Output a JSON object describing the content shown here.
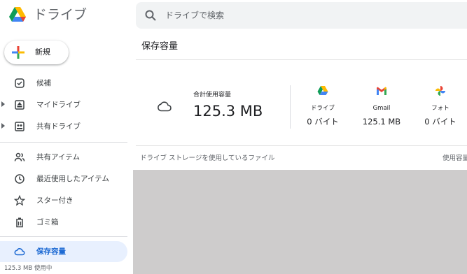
{
  "app": {
    "name": "ドライブ"
  },
  "search": {
    "placeholder": "ドライブで検索"
  },
  "sidebar": {
    "new_label": "新規",
    "items": [
      {
        "label": "候補"
      },
      {
        "label": "マイドライブ"
      },
      {
        "label": "共有ドライブ"
      },
      {
        "label": "共有アイテム"
      },
      {
        "label": "最近使用したアイテム"
      },
      {
        "label": "スター付き"
      },
      {
        "label": "ゴミ箱"
      },
      {
        "label": "保存容量"
      }
    ],
    "usage_text": "125.3 MB 使用中"
  },
  "main": {
    "title": "保存容量",
    "total_label": "合計使用容量",
    "total_value": "125.3 MB",
    "services": [
      {
        "name": "ドライブ",
        "value": "0 バイト",
        "icon": "drive-icon"
      },
      {
        "name": "Gmail",
        "value": "125.1 MB",
        "icon": "gmail-icon"
      },
      {
        "name": "フォト",
        "value": "0 バイト",
        "icon": "photos-icon"
      }
    ],
    "files_header": "ドライブ  ストレージを使用しているファイル",
    "files_header_right": "使用容量"
  },
  "colors": {
    "accent": "#1967d2",
    "active_bg": "#e8f0fe",
    "search_bg": "#f1f3f4",
    "placeholder_area": "#cecccc"
  }
}
